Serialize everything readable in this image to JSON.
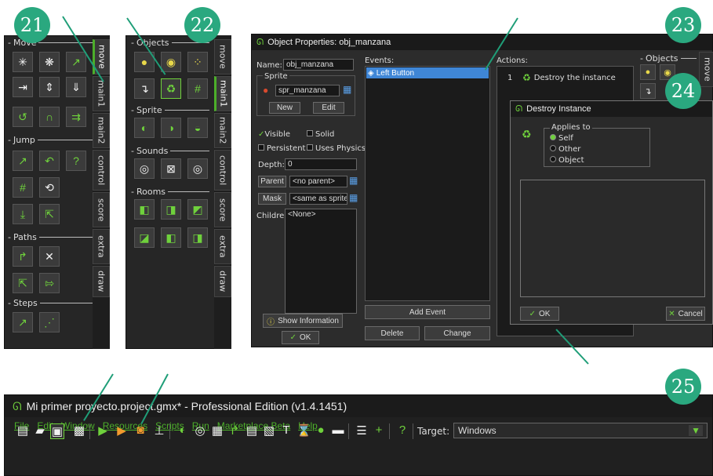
{
  "badges": {
    "b21": "21",
    "b22": "22",
    "b23": "23",
    "b24": "24",
    "b25": "25"
  },
  "panel1": {
    "section_move": "Move",
    "section_jump": "Jump",
    "section_paths": "Paths",
    "section_steps": "Steps",
    "tabs": [
      "move",
      "main1",
      "main2",
      "control",
      "score",
      "extra",
      "draw"
    ]
  },
  "panel2": {
    "section_objects": "Objects",
    "section_sprite": "Sprite",
    "section_sounds": "Sounds",
    "section_rooms": "Rooms",
    "tabs": [
      "move",
      "main1",
      "main2",
      "control",
      "score",
      "extra",
      "draw"
    ]
  },
  "obj": {
    "title": "Object Properties: obj_manzana",
    "name_label": "Name:",
    "name_value": "obj_manzana",
    "sprite_label": "Sprite",
    "sprite_value": "spr_manzana",
    "new_btn": "New",
    "edit_btn": "Edit",
    "visible": "Visible",
    "solid": "Solid",
    "persistent": "Persistent",
    "uses_physics": "Uses Physics",
    "depth_label": "Depth:",
    "depth_value": "0",
    "parent_btn": "Parent",
    "parent_value": "<no parent>",
    "mask_btn": "Mask",
    "mask_value": "<same as sprite>",
    "children_label": "Children:",
    "children_value": "<None>",
    "show_info": "Show Information",
    "ok": "OK",
    "events_label": "Events:",
    "event_item": "Left Button",
    "add_event": "Add Event",
    "delete": "Delete",
    "change": "Change",
    "actions_label": "Actions:",
    "action_num": "1",
    "action_item": "Destroy the instance",
    "objects_label": "Objects",
    "side_tab": "move"
  },
  "destroy": {
    "title": "Destroy Instance",
    "applies_to": "Applies to",
    "self": "Self",
    "other": "Other",
    "object": "Object",
    "ok": "OK",
    "cancel": "Cancel"
  },
  "ide": {
    "title": "Mi primer proyecto.project.gmx* - Professional Edition (v1.4.1451)",
    "menu": [
      "File",
      "Edit",
      "Window",
      "Resources",
      "Scripts",
      "Run",
      "Marketplace Beta",
      "Help"
    ],
    "target_label": "Target:",
    "target_value": "Windows"
  },
  "colors": {
    "accent": "#2aa87f",
    "green": "#4caf2a",
    "dark": "#262626"
  }
}
